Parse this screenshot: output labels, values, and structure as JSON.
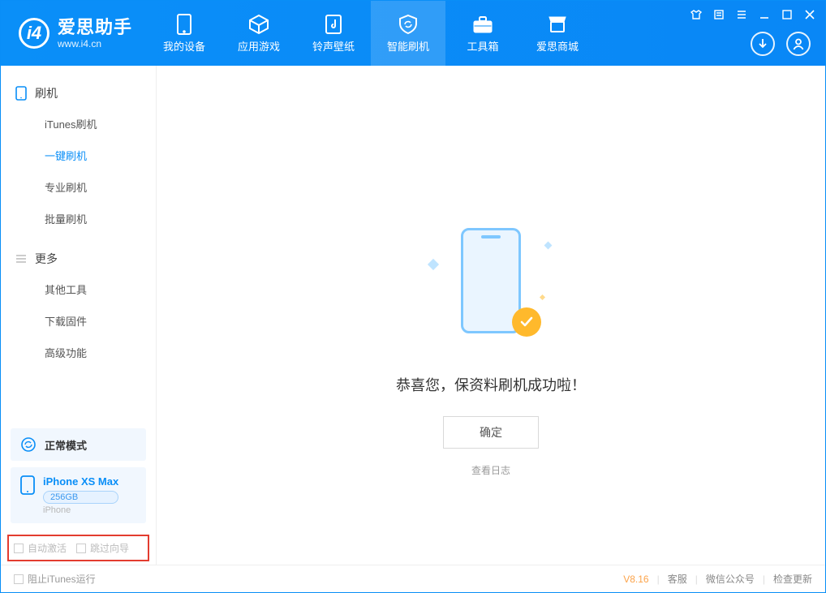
{
  "app": {
    "name": "爱思助手",
    "url": "www.i4.cn"
  },
  "nav": {
    "items": [
      {
        "label": "我的设备"
      },
      {
        "label": "应用游戏"
      },
      {
        "label": "铃声壁纸"
      },
      {
        "label": "智能刷机"
      },
      {
        "label": "工具箱"
      },
      {
        "label": "爱思商城"
      }
    ],
    "active_index": 3
  },
  "sidebar": {
    "group1_title": "刷机",
    "group1_items": [
      "iTunes刷机",
      "一键刷机",
      "专业刷机",
      "批量刷机"
    ],
    "group1_active_index": 1,
    "group2_title": "更多",
    "group2_items": [
      "其他工具",
      "下载固件",
      "高级功能"
    ]
  },
  "device": {
    "mode_label": "正常模式",
    "name": "iPhone XS Max",
    "capacity": "256GB",
    "type": "iPhone"
  },
  "options": {
    "auto_activate": "自动激活",
    "skip_guide": "跳过向导"
  },
  "main": {
    "message": "恭喜您，保资料刷机成功啦！",
    "ok_label": "确定",
    "view_log": "查看日志"
  },
  "footer": {
    "block_itunes": "阻止iTunes运行",
    "version": "V8.16",
    "links": [
      "客服",
      "微信公众号",
      "检查更新"
    ]
  }
}
